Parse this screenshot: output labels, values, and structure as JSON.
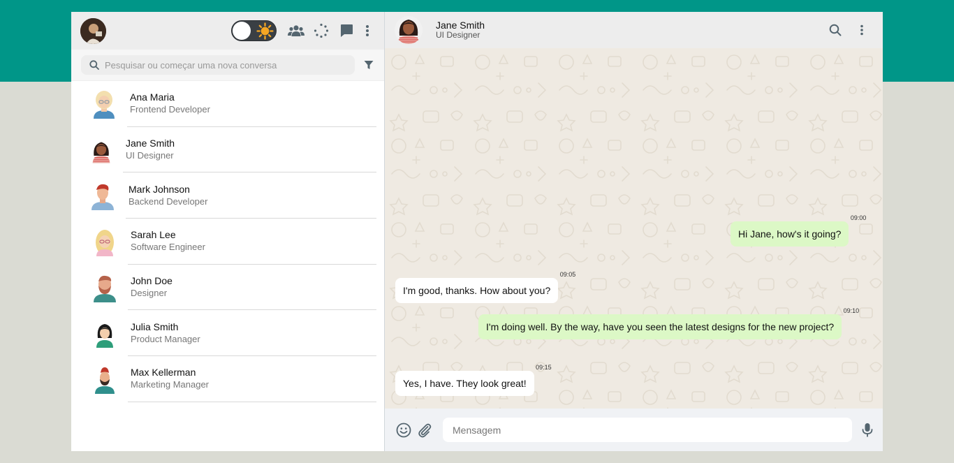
{
  "left_panel": {
    "my_avatar_alt": "profile",
    "search_placeholder": "Pesquisar ou começar uma nova conversa",
    "icons": [
      "theme-toggle",
      "community-icon",
      "status-icon",
      "new-chat-icon",
      "menu-icon",
      "filter-icon"
    ]
  },
  "contacts": [
    {
      "name": "Ana Maria",
      "role": "Frontend Developer"
    },
    {
      "name": "Jane Smith",
      "role": "UI Designer"
    },
    {
      "name": "Mark Johnson",
      "role": "Backend Developer"
    },
    {
      "name": "Sarah Lee",
      "role": "Software Engineer"
    },
    {
      "name": "John Doe",
      "role": "Designer"
    },
    {
      "name": "Julia Smith",
      "role": "Product Manager"
    },
    {
      "name": "Max Kellerman",
      "role": "Marketing Manager"
    }
  ],
  "chat": {
    "name": "Jane Smith",
    "role": "UI Designer",
    "messages": [
      {
        "dir": "out",
        "text": "Hi Jane, how's it going?",
        "time": "09:00"
      },
      {
        "dir": "in",
        "text": "I'm good, thanks. How about you?",
        "time": "09:05"
      },
      {
        "dir": "out",
        "text": "I'm doing well. By the way, have you seen the latest designs for the new project?",
        "time": "09:10"
      },
      {
        "dir": "in",
        "text": "Yes, I have. They look great!",
        "time": "09:15"
      }
    ],
    "composer_placeholder": "Mensagem"
  },
  "colors": {
    "teal": "#009688",
    "outgoing": "#dcf8c6",
    "incoming": "#ffffff",
    "chat_bg": "#efeae2"
  }
}
